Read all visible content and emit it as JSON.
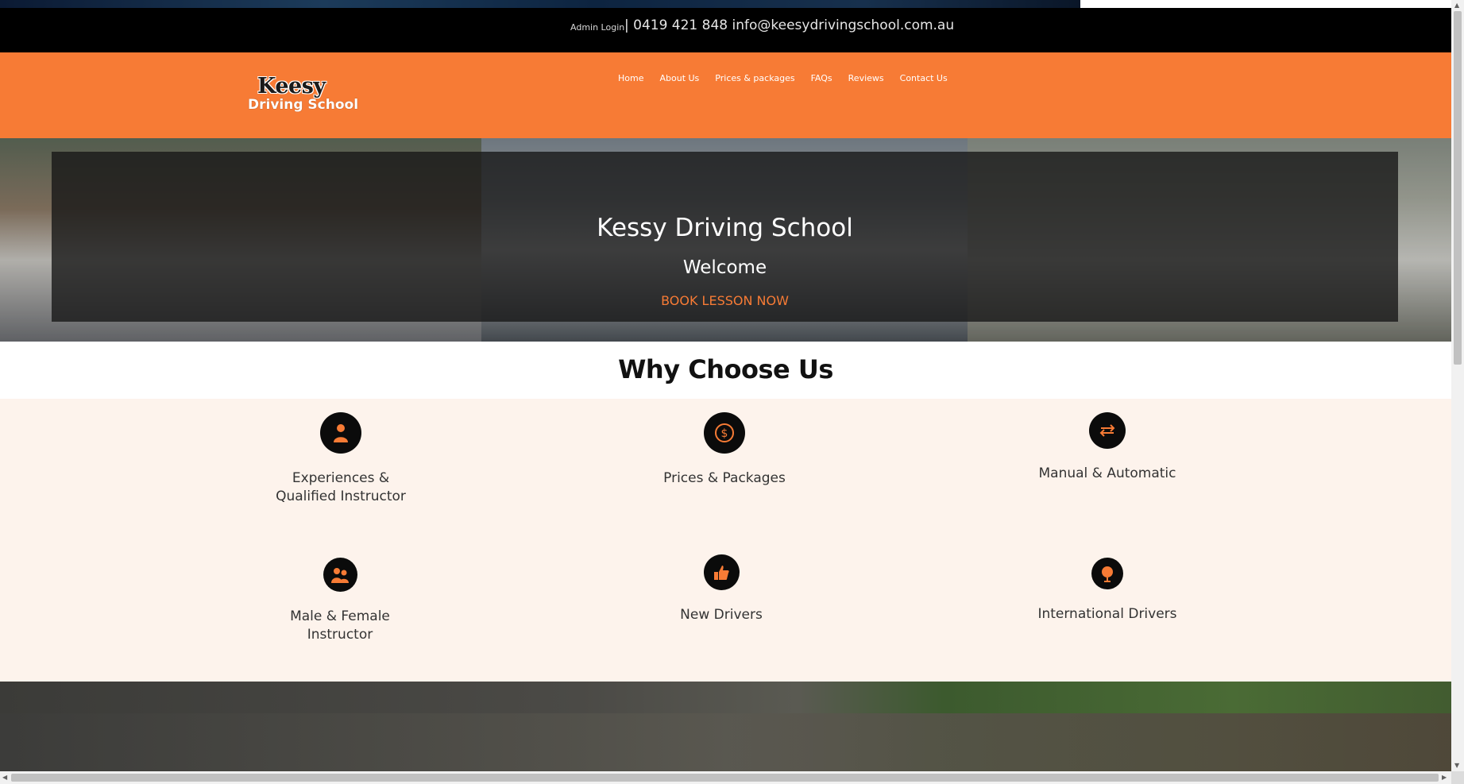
{
  "top_bar": {
    "admin_login": "Admin Login",
    "contact_text": "| 0419 421 848 info@keesydrivingschool.com.au"
  },
  "logo": {
    "line1": "Keesy",
    "line2": "Driving School"
  },
  "nav": {
    "items": [
      "Home",
      "About Us",
      "Prices & packages",
      "FAQs",
      "Reviews",
      "Contact Us"
    ]
  },
  "hero": {
    "title": "Kessy Driving School",
    "subtitle": "Welcome",
    "cta": "BOOK LESSON NOW"
  },
  "why": {
    "title": "Why Choose Us",
    "features": [
      {
        "label": "Experiences & Qualified Instructor",
        "icon": "person-icon"
      },
      {
        "label": "Prices & Packages",
        "icon": "dollar-icon"
      },
      {
        "label": "Manual & Automatic",
        "icon": "transmission-arrows-icon"
      },
      {
        "label": "Male & Female Instructor",
        "icon": "people-icon"
      },
      {
        "label": "New Drivers",
        "icon": "thumbs-up-icon"
      },
      {
        "label": "International Drivers",
        "icon": "globe-icon"
      }
    ]
  },
  "colors": {
    "accent": "#f77b35",
    "top_bar": "#000000",
    "feature_bg": "#fdf3ec",
    "icon_circle": "#0b0b0b"
  }
}
